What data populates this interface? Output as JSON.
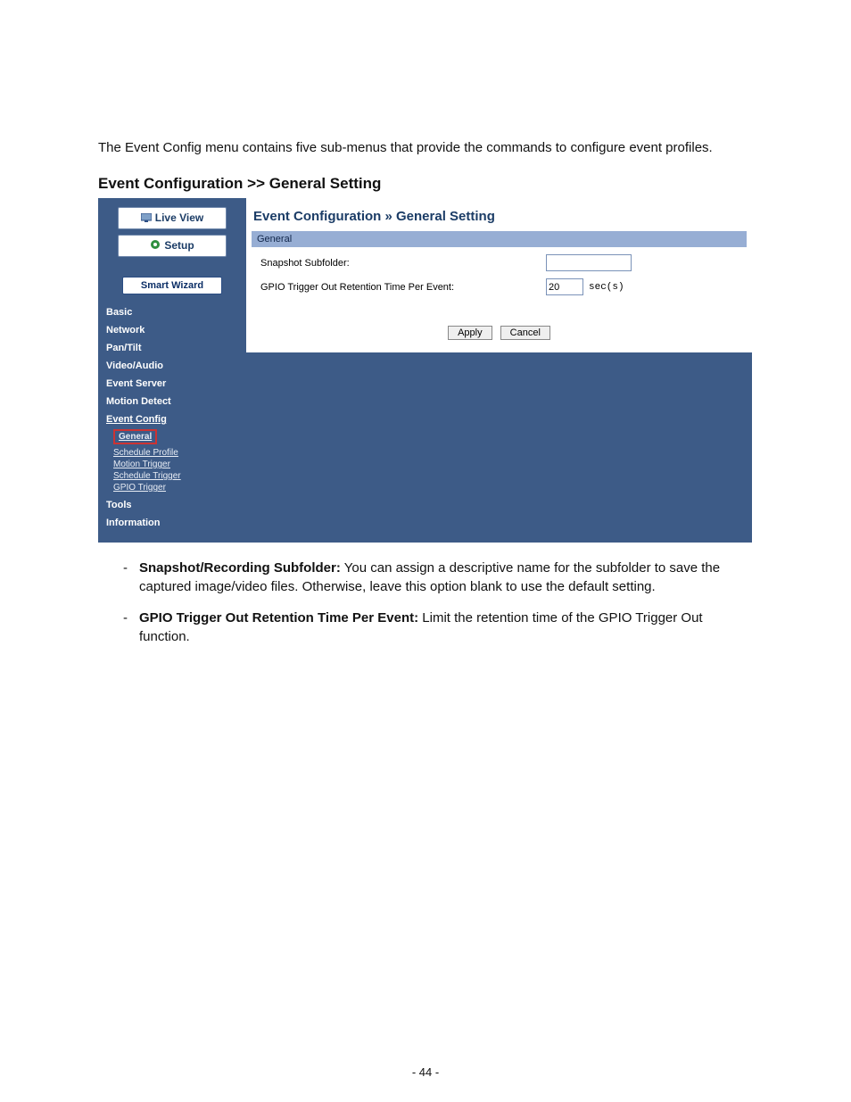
{
  "intro": "The Event Config menu contains five sub-menus that provide the commands to configure event profiles.",
  "heading": "Event Configuration >> General Setting",
  "sidebar": {
    "live_view": "Live View",
    "setup": "Setup",
    "smart_wizard": "Smart Wizard",
    "items": [
      "Basic",
      "Network",
      "Pan/Tilt",
      "Video/Audio",
      "Event Server",
      "Motion Detect"
    ],
    "event_config_label": "Event Config",
    "event_config_children": [
      "General",
      "Schedule Profile",
      "Motion Trigger",
      "Schedule Trigger",
      "GPIO Trigger"
    ],
    "tail_items": [
      "Tools",
      "Information"
    ]
  },
  "content": {
    "breadcrumb": "Event Configuration » General Setting",
    "section_bar": "General",
    "row1_label": "Snapshot Subfolder:",
    "row1_value": "",
    "row2_label": "GPIO Trigger Out Retention Time Per Event:",
    "row2_value": "20",
    "row2_unit": "sec(s)",
    "apply": "Apply",
    "cancel": "Cancel"
  },
  "notes": {
    "n1_strong": "Snapshot/Recording Subfolder:",
    "n1_text": " You can assign a descriptive name for the subfolder to save the captured image/video files. Otherwise, leave this option blank to use the default setting.",
    "n2_strong": "GPIO Trigger Out Retention Time Per Event:",
    "n2_text": " Limit the retention time of the GPIO Trigger Out function."
  },
  "page_number": "- 44 -"
}
